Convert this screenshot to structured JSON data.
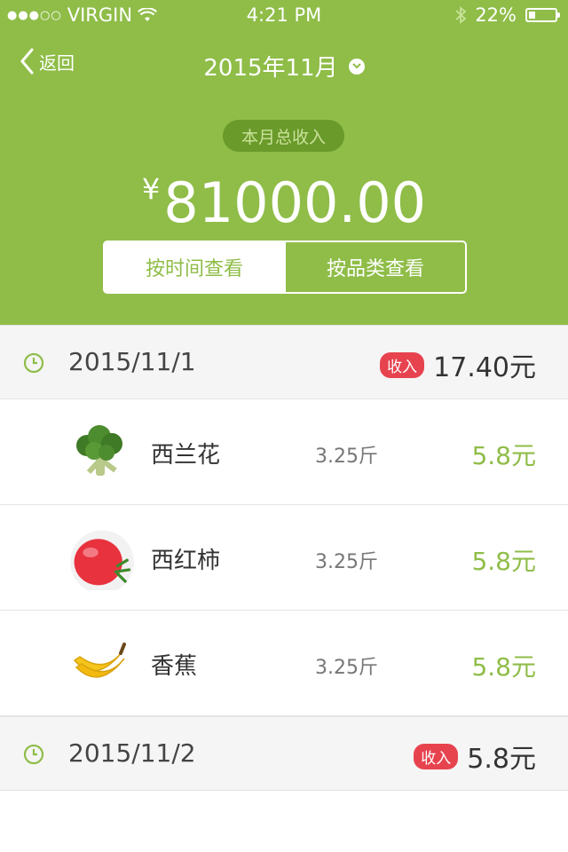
{
  "status_bar": {
    "carrier": "VIRGIN",
    "time": "4:21 PM",
    "battery": "22%"
  },
  "nav": {
    "back_label": "返回",
    "month_title": "2015年11月"
  },
  "summary": {
    "badge": "本月总收入",
    "currency": "¥",
    "amount": "81000.00"
  },
  "segmented": {
    "by_time": "按时间查看",
    "by_category": "按品类查看"
  },
  "days": [
    {
      "date": "2015/11/1",
      "tag": "收入",
      "total": "17.40元",
      "items": [
        {
          "name": "西兰花",
          "weight": "3.25斤",
          "price": "5.8元",
          "icon": "broccoli-icon"
        },
        {
          "name": "西红柿",
          "weight": "3.25斤",
          "price": "5.8元",
          "icon": "tomato-icon"
        },
        {
          "name": "香蕉",
          "weight": "3.25斤",
          "price": "5.8元",
          "icon": "banana-icon"
        }
      ]
    },
    {
      "date": "2015/11/2",
      "tag": "收入",
      "total": "5.8元",
      "items": []
    }
  ],
  "colors": {
    "brand_green": "#8fbd48",
    "badge_red": "#e7434f"
  }
}
